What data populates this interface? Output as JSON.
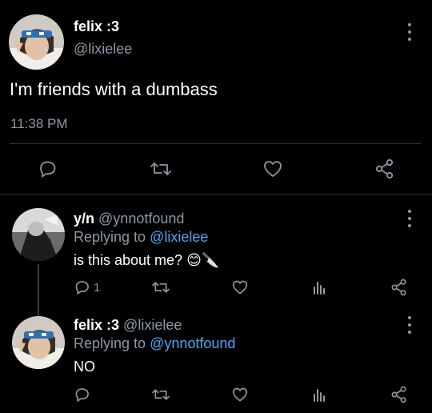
{
  "main_tweet": {
    "display_name": "felix :3",
    "handle": "@lixielee",
    "text": "I'm friends with a dumbass",
    "time": "11:38 PM"
  },
  "replies": [
    {
      "display_name": "y/n",
      "handle": "@ynnotfound",
      "replying_prefix": "Replying to",
      "replying_to": "@lixielee",
      "text": "is this about me? 😊🔪",
      "reply_count": "1"
    },
    {
      "display_name": "felix :3",
      "handle": "@lixielee",
      "replying_prefix": "Replying to",
      "replying_to": "@ynnotfound",
      "text": "NO",
      "reply_count": ""
    }
  ],
  "icons": {
    "reply": "reply-icon",
    "retweet": "retweet-icon",
    "like": "heart-icon",
    "analytics": "analytics-icon",
    "share": "share-icon",
    "more": "more-vertical-icon"
  },
  "colors": {
    "background": "#000000",
    "text": "#e7e9ea",
    "muted": "#8b98a5",
    "link": "#4ea6f0",
    "divider": "#2f3336"
  }
}
